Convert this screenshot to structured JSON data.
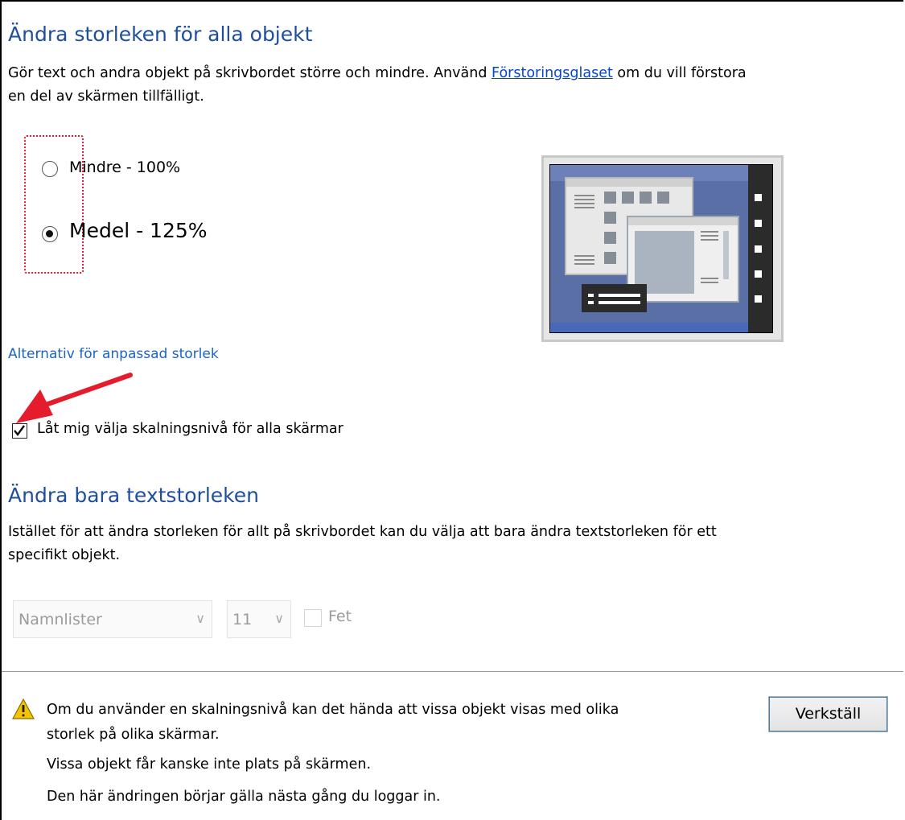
{
  "section1": {
    "title": "Ändra storleken för alla objekt",
    "desc_before_link": "Gör text och andra objekt på skrivbordet större och mindre. Använd ",
    "link": "Förstoringsglaset",
    "desc_after_link": " om du vill förstora",
    "desc_line2": "en del av skärmen tillfälligt."
  },
  "options": [
    {
      "label": "Mindre - 100%",
      "selected": false
    },
    {
      "label": "Medel - 125%",
      "selected": true
    }
  ],
  "custom_link": "Alternativ för anpassad storlek",
  "checkbox": {
    "label": "Låt mig välja skalningsnivå för alla skärmar",
    "checked": true
  },
  "section2": {
    "title": "Ändra bara textstorleken",
    "desc_line1": "Istället för att ändra storleken för allt på skrivbordet kan du välja att bara ändra textstorleken för ett",
    "desc_line2": "specifikt objekt."
  },
  "text_controls": {
    "item": "Namnlister",
    "size": "11",
    "bold_label": "Fet",
    "bold_checked": false,
    "chevron": "∨"
  },
  "warning": {
    "line1": "Om du använder en skalningsnivå kan det hända att vissa objekt visas med olika",
    "line2": "storlek på olika skärmar.",
    "line3": "Vissa objekt får kanske inte plats på skärmen.",
    "line4": "Den här ändringen börjar gälla nästa gång du loggar in."
  },
  "apply_button": "Verkställ",
  "colors": {
    "heading": "#1f4e9c",
    "link": "#1a63c7",
    "annotation": "#e41c2c"
  }
}
